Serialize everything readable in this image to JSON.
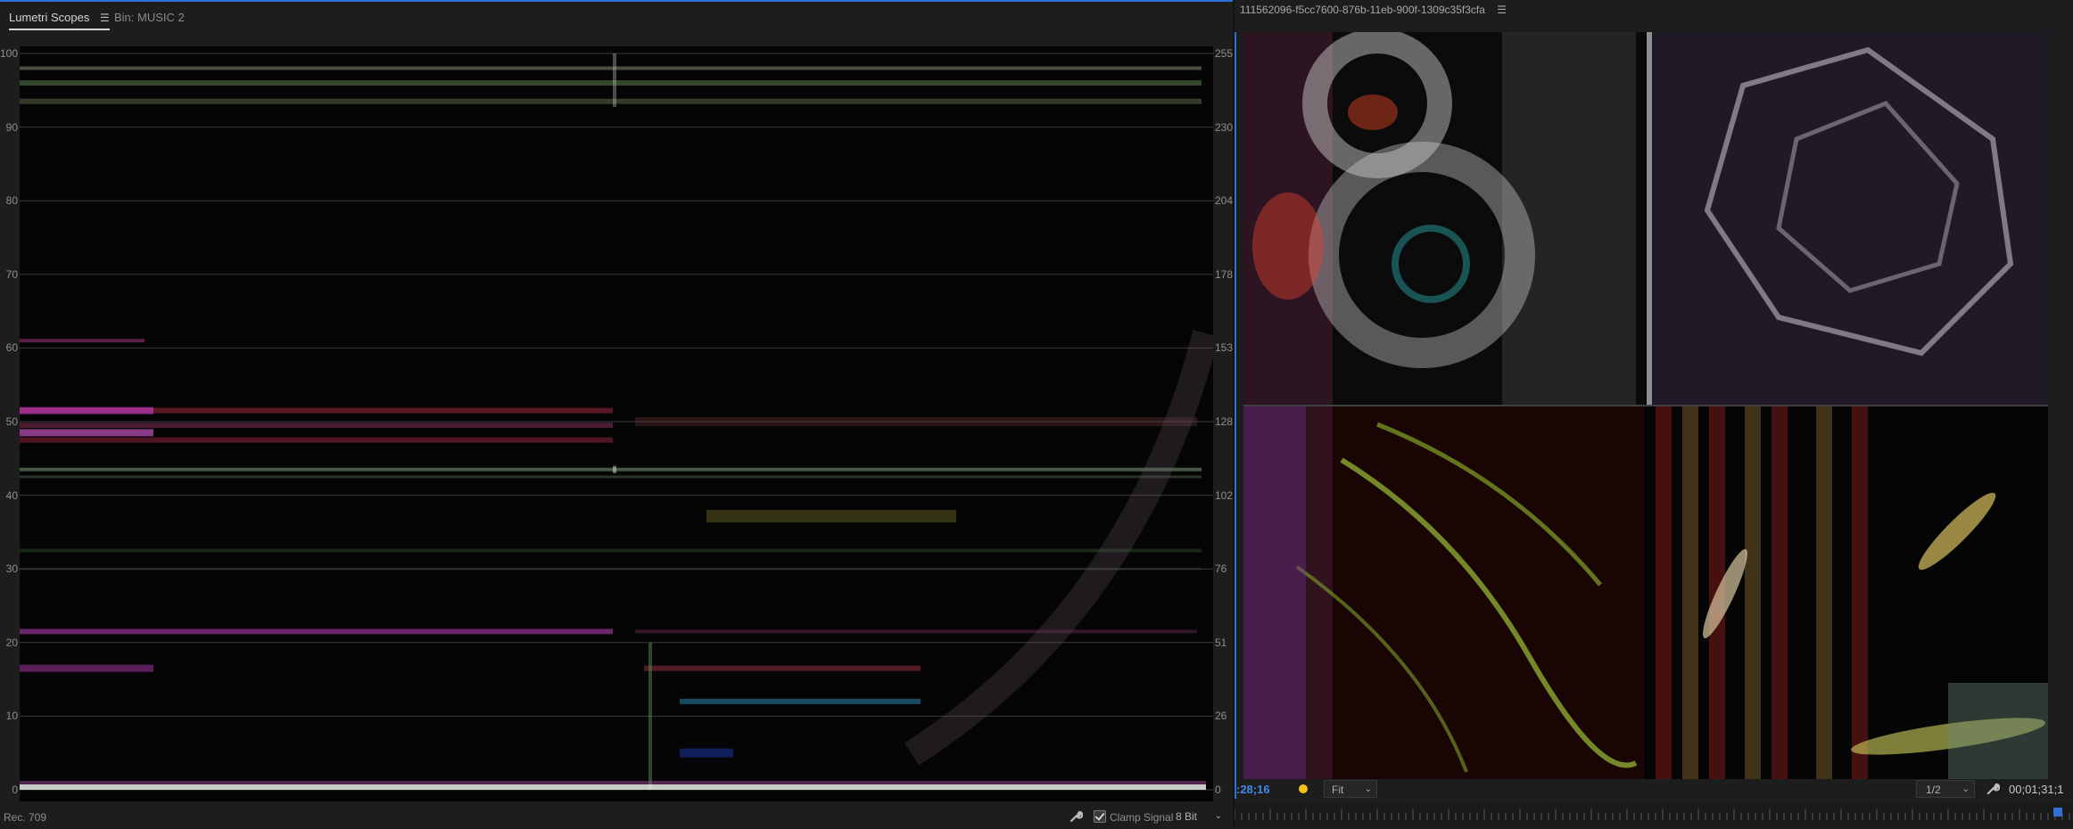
{
  "left_panel": {
    "tabs": [
      {
        "label": "Lumetri Scopes",
        "active": true
      },
      {
        "label": "Bin: MUSIC 2",
        "active": false
      }
    ],
    "menu_icon": "hamburger-icon",
    "scope": {
      "type": "waveform",
      "left_axis": [
        "100",
        "90",
        "80",
        "70",
        "60",
        "50",
        "40",
        "30",
        "20",
        "10",
        "0"
      ],
      "right_axis": [
        "255",
        "230",
        "204",
        "178",
        "153",
        "128",
        "102",
        "76",
        "51",
        "26",
        "0"
      ]
    },
    "footer": {
      "color_space": "Rec. 709",
      "settings_icon": "wrench-icon",
      "clamp_checked": true,
      "clamp_label": "Clamp Signal",
      "bit_depth": "8 Bit"
    }
  },
  "right_panel": {
    "clip_title": "111562096-f5cc7600-876b-11eb-900f-1309c35f3cfa",
    "menu_icon": "hamburger-icon",
    "timecode_current": ":28;16",
    "zoom": "Fit",
    "resolution": "1/2",
    "settings_icon": "wrench-icon",
    "timecode_duration": "00;01;31;1",
    "marker_color": "#f2c21b",
    "accent_color": "#2f6fd6"
  }
}
